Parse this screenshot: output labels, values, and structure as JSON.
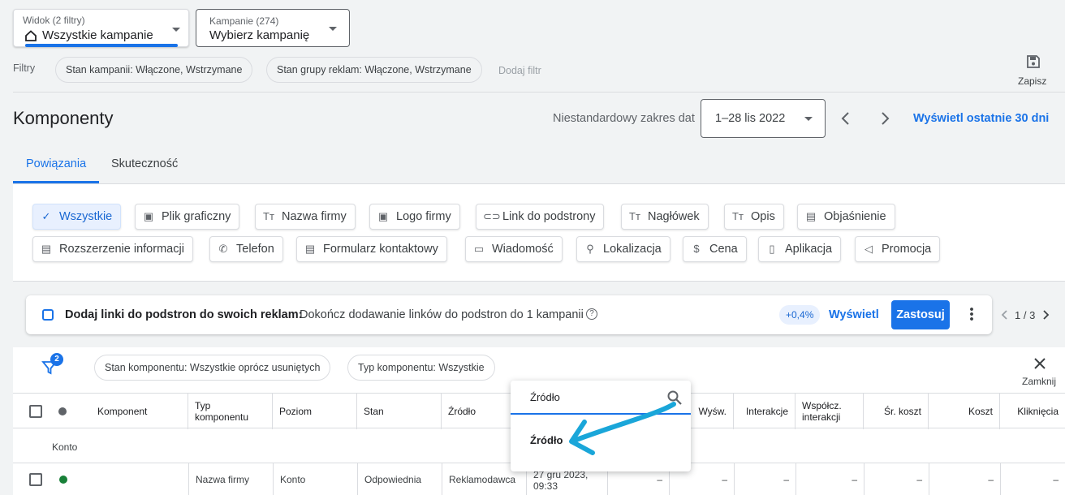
{
  "header": {
    "view": {
      "label": "Widok (2 filtry)",
      "value": "Wszystkie kampanie"
    },
    "campaigns": {
      "label": "Kampanie (274)",
      "value": "Wybierz kampanię"
    },
    "filters_label": "Filtry",
    "filter_chips": [
      "Stan kampanii: Włączone, Wstrzymane",
      "Stan grupy reklam: Włączone, Wstrzymane"
    ],
    "add_filter": "Dodaj filtr",
    "save": "Zapisz"
  },
  "page": {
    "title": "Komponenty",
    "date_label": "Niestandardowy zakres dat",
    "date_value": "1–28 lis 2022",
    "last30": "Wyświetl ostatnie 30 dni"
  },
  "tabs": [
    "Powiązania",
    "Skuteczność"
  ],
  "type_filters": [
    {
      "label": "Wszystkie",
      "icon": "check"
    },
    {
      "label": "Plik graficzny",
      "icon": "image"
    },
    {
      "label": "Nazwa firmy",
      "icon": "text"
    },
    {
      "label": "Logo firmy",
      "icon": "image"
    },
    {
      "label": "Link do podstrony",
      "icon": "link"
    },
    {
      "label": "Nagłówek",
      "icon": "text"
    },
    {
      "label": "Opis",
      "icon": "text"
    },
    {
      "label": "Objaśnienie",
      "icon": "doc"
    },
    {
      "label": "Rozszerzenie informacji",
      "icon": "doc"
    },
    {
      "label": "Telefon",
      "icon": "phone"
    },
    {
      "label": "Formularz kontaktowy",
      "icon": "form"
    },
    {
      "label": "Wiadomość",
      "icon": "message"
    },
    {
      "label": "Lokalizacja",
      "icon": "pin"
    },
    {
      "label": "Cena",
      "icon": "price"
    },
    {
      "label": "Aplikacja",
      "icon": "mobile"
    },
    {
      "label": "Promocja",
      "icon": "megaphone"
    }
  ],
  "recommendation": {
    "title": "Dodaj linki do podstron do swoich reklam:",
    "text": "Dokończ dodawanie linków do podstron do 1 kampanii",
    "badge": "+0,4%",
    "view": "Wyświetl",
    "apply": "Zastosuj",
    "pager": "1 / 3"
  },
  "table_filters": {
    "badge": "2",
    "chips": [
      "Stan komponentu: Wszystkie oprócz usuniętych",
      "Typ komponentu: Wszystkie"
    ],
    "close": "Zamknij"
  },
  "table": {
    "columns": [
      "Komponent",
      "Typ komponentu",
      "Poziom",
      "Stan",
      "Źródło",
      "Wyśw.",
      "Interakcje",
      "Współcz. interakcji",
      "Śr. koszt",
      "Koszt",
      "Kliknięcia"
    ],
    "group": "Konto",
    "row": {
      "type": "Nazwa firmy",
      "level": "Konto",
      "status": "Odpowiednia",
      "source": "Reklamodawca",
      "date": "27 gru 2023, 09:33",
      "dash": "–"
    }
  },
  "search_popup": {
    "input": "Źródło",
    "result": "Źródło"
  },
  "colors": {
    "accent": "#1a73e8",
    "arrow": "#1aa6d9",
    "status_green": "#188038"
  }
}
